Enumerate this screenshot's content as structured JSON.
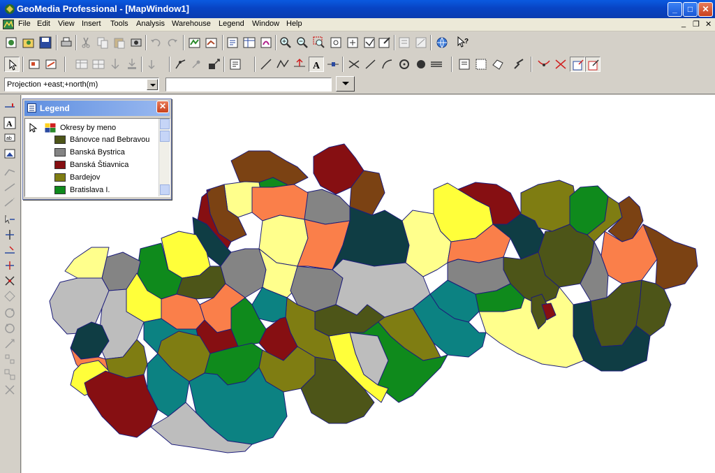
{
  "window": {
    "title": "GeoMedia Professional - [MapWindow1]",
    "minimize": "_",
    "maximize": "□",
    "close": "✕"
  },
  "menu": [
    "File",
    "Edit",
    "View",
    "Insert",
    "Tools",
    "Analysis",
    "Warehouse",
    "Legend",
    "Window",
    "Help"
  ],
  "mdi_controls": {
    "minimize": "_",
    "restore": "❐",
    "close": "✕"
  },
  "toolbar": {
    "coord_system": "Projection +east;+north(m)",
    "secondary_combo": ""
  },
  "legend": {
    "title": "Legend",
    "close": "✕",
    "feature_class": "Okresy by meno",
    "entries": [
      {
        "name": "Bánovce nad Bebravou",
        "color": "#4d5518"
      },
      {
        "name": "Banská Bystrica",
        "color": "#848484"
      },
      {
        "name": "Banská Štiavnica",
        "color": "#860f12"
      },
      {
        "name": "Bardejov",
        "color": "#7f7d12"
      },
      {
        "name": "Bratislava I.",
        "color": "#0f8a1c"
      }
    ]
  },
  "colors": {
    "brown": "#7b4213",
    "maroon": "#860f12",
    "grey": "#848484",
    "light_grey": "#bdbdbd",
    "yellow": "#ffff3a",
    "light_yellow": "#ffff8c",
    "orange": "#fa7f4a",
    "dark_teal": "#0f3d44",
    "teal": "#0c8282",
    "olive": "#7f7d12",
    "dark_olive": "#4d5518",
    "green": "#0f8a1c"
  }
}
